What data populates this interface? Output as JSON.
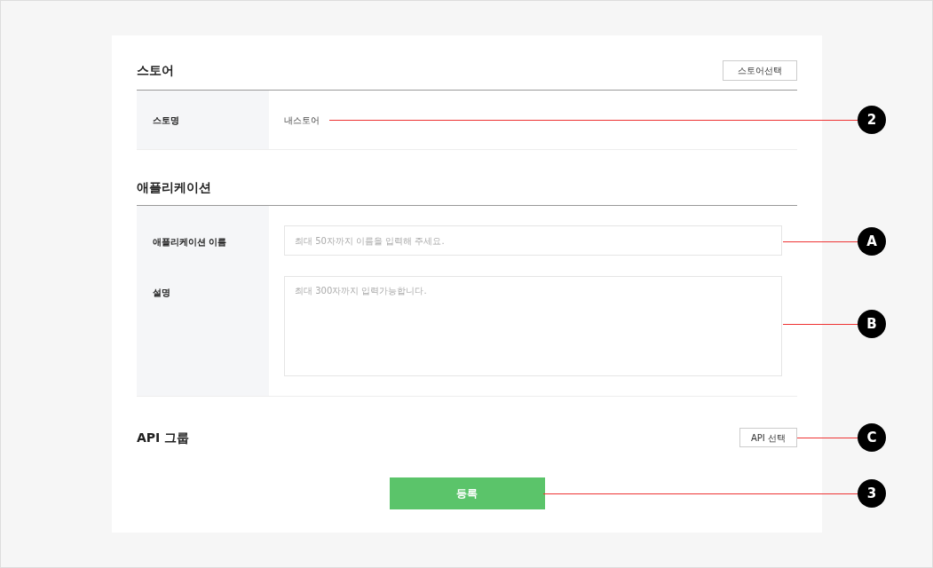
{
  "store": {
    "title": "스토어",
    "select_button": "스토어선택",
    "rows": [
      {
        "label": "스토명",
        "value": "내스토어"
      }
    ]
  },
  "application": {
    "title": "애플리케이션",
    "fields": [
      {
        "kind": "input",
        "label": "애플리케이션 이름",
        "placeholder": "최대 50자까지 이름을 입력해 주세요."
      },
      {
        "kind": "textarea",
        "label": "설명",
        "placeholder": "최대 300자까지 입력가능합니다."
      }
    ]
  },
  "api_group": {
    "title": "API 그룹",
    "select_button": "API 선택"
  },
  "submit_button": "등록",
  "annotations": [
    {
      "label": "2"
    },
    {
      "label": "A"
    },
    {
      "label": "B"
    },
    {
      "label": "C"
    },
    {
      "label": "3"
    }
  ]
}
